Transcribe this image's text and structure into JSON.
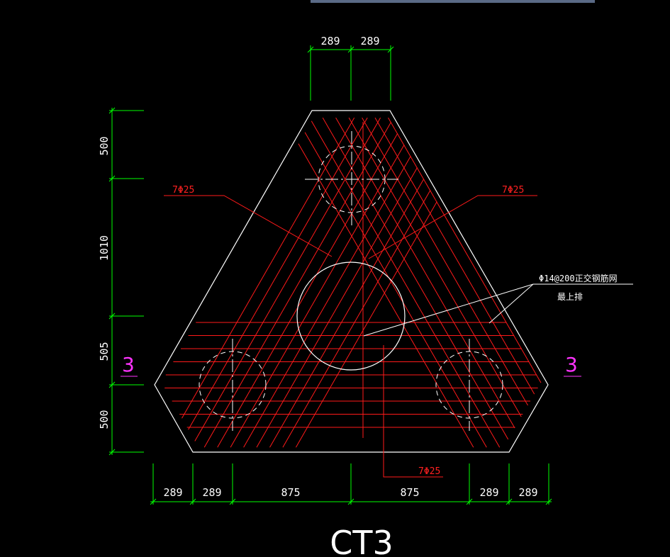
{
  "colors": {
    "outline": "#ffffff",
    "rebar": "#ff1a1a",
    "dimension": "#00ff00",
    "section_mark": "#ff33ff",
    "background": "#000000"
  },
  "top_dimensions": [
    "289",
    "289"
  ],
  "left_dimensions": [
    "500",
    "1010",
    "505",
    "500"
  ],
  "bottom_dimensions": [
    "289",
    "289",
    "875",
    "875",
    "289",
    "289"
  ],
  "rebar_labels": {
    "left": "7Φ25",
    "right": "7Φ25",
    "bottom": "7Φ25"
  },
  "mesh_note": {
    "line1": "Φ14@200正交钢筋网",
    "line2": "最上排"
  },
  "section_marks": {
    "left": "3",
    "right": "3"
  },
  "title": "CT3"
}
